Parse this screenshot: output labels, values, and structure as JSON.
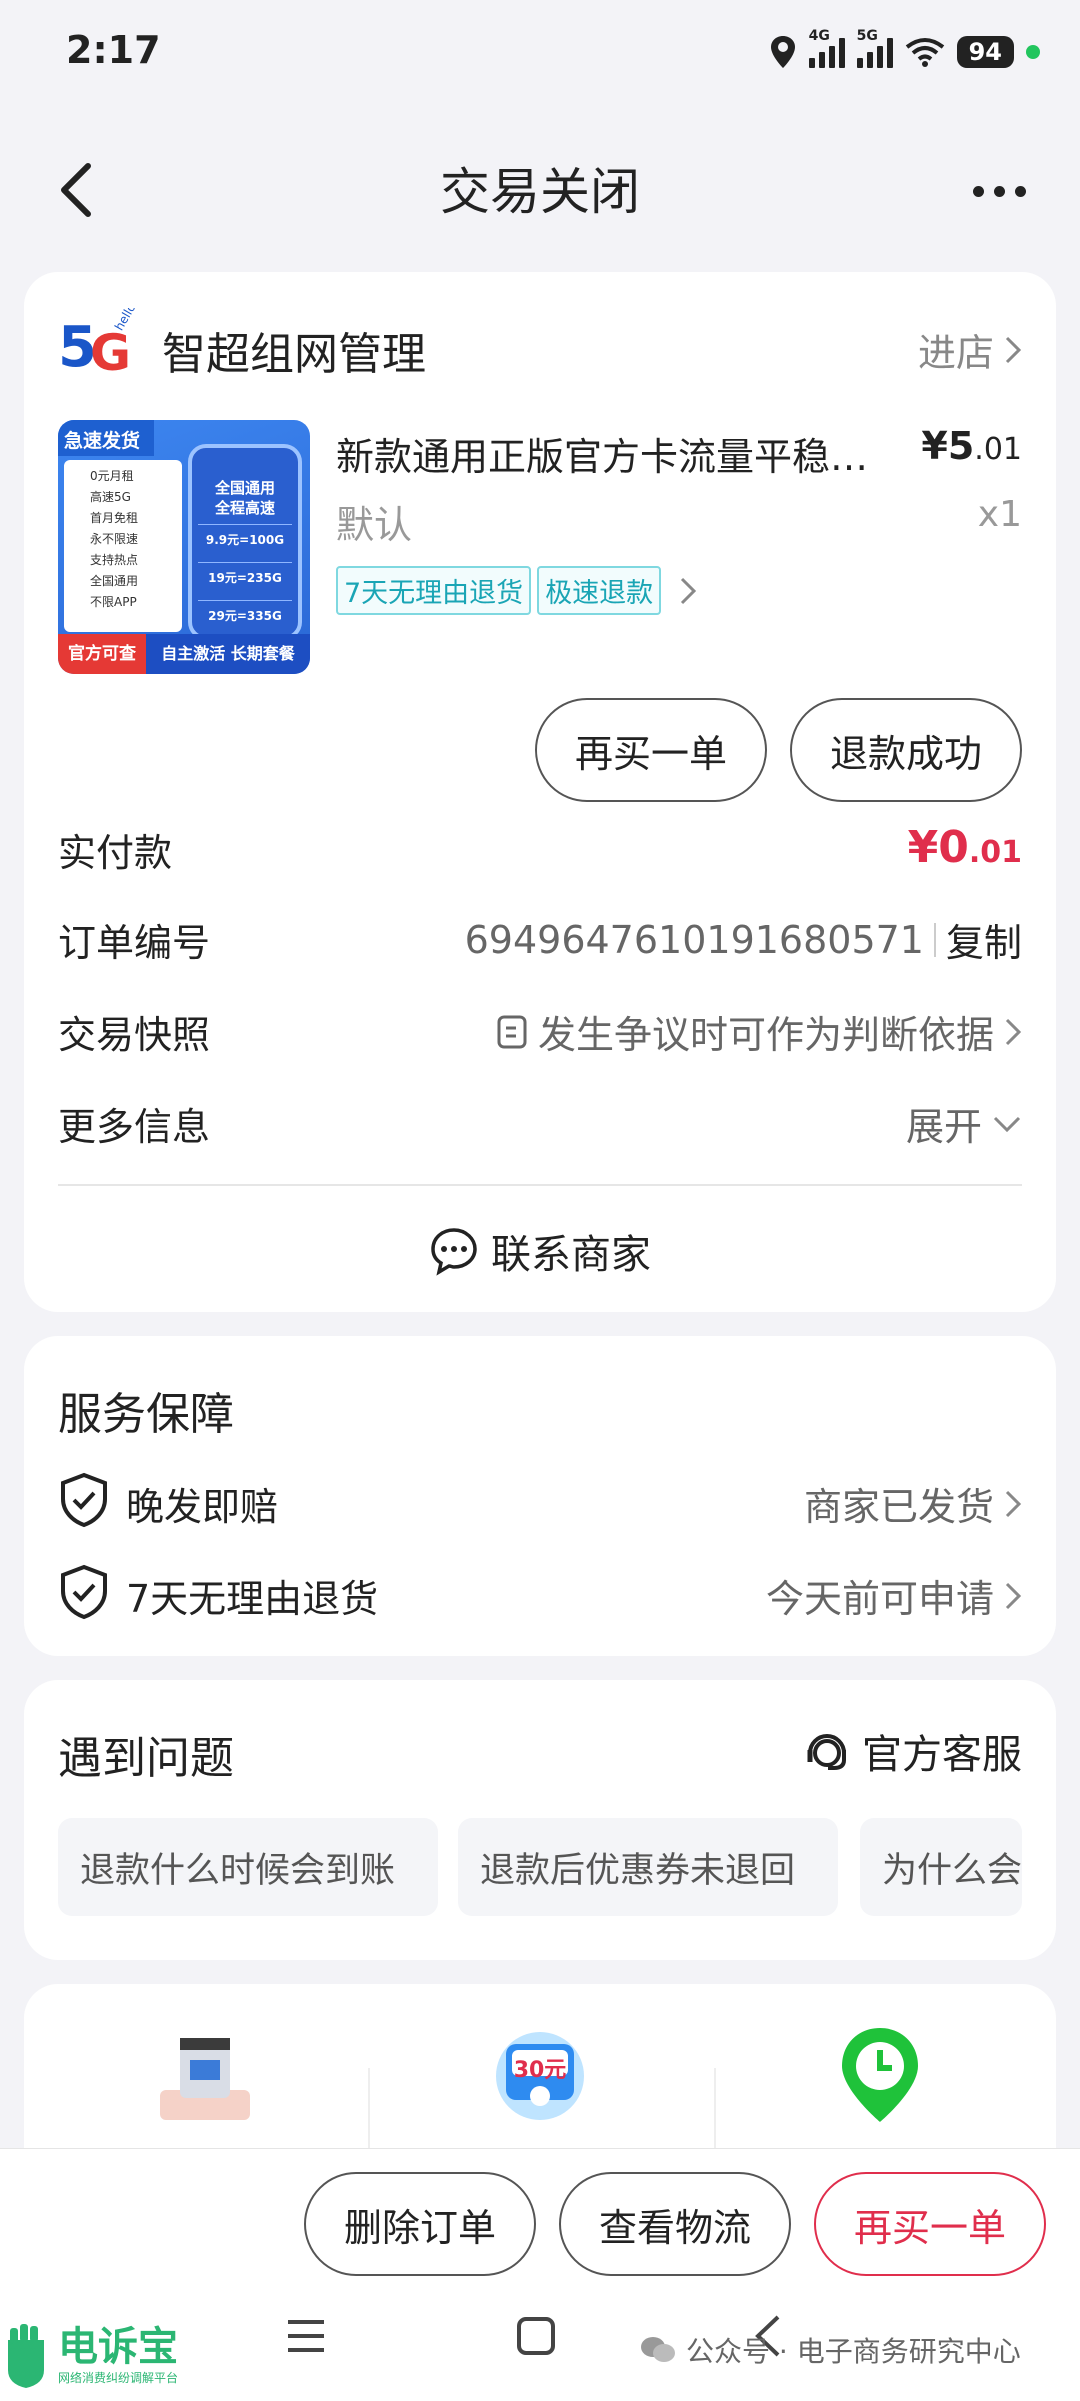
{
  "status": {
    "time": "2:17",
    "battery": "94",
    "net1": "4G",
    "net2": "5G"
  },
  "header": {
    "title": "交易关闭"
  },
  "shop": {
    "logo_text": "5G",
    "logo_sub": "hello",
    "name": "智超组网管理",
    "enter": "进店"
  },
  "product": {
    "thumb": {
      "head": "急速发货",
      "list": [
        "0元月租",
        "高速5G",
        "首月免租",
        "永不限速",
        "支持热点",
        "全国通用",
        "不限APP"
      ],
      "phone_title": "全国通用\n全程高速",
      "plans": [
        "9.9元=100G",
        "19元=235G",
        "29元=335G"
      ],
      "foot_left": "官方可查",
      "foot_right": "自主激活 长期套餐"
    },
    "title": "新款通用正版官方卡流量平稳…",
    "price_main": "¥5",
    "price_dec": ".01",
    "sku": "默认",
    "qty": "x1",
    "tags": [
      "7天无理由退货",
      "极速退款"
    ]
  },
  "actions": {
    "rebuy": "再买一单",
    "refund": "退款成功"
  },
  "order": {
    "paid_label": "实付款",
    "paid_main": "¥0",
    "paid_dec": ".01",
    "no_label": "订单编号",
    "no_value": "6949647610191680571",
    "copy": "复制",
    "snapshot_label": "交易快照",
    "snapshot_value": "发生争议时可作为判断依据",
    "more_label": "更多信息",
    "more_value": "展开",
    "contact": "联系商家"
  },
  "service": {
    "title": "服务保障",
    "items": [
      {
        "label": "晚发即赔",
        "value": "商家已发货"
      },
      {
        "label": "7天无理由退货",
        "value": "今天前可申请"
      }
    ]
  },
  "faq": {
    "title": "遇到问题",
    "support": "官方客服",
    "chips": [
      "退款什么时候会到账",
      "退款后优惠券未退回",
      "为什么会"
    ]
  },
  "promo": {
    "coupon": "30元"
  },
  "bottom": {
    "delete": "删除订单",
    "logistics": "查看物流",
    "rebuy": "再买一单"
  },
  "watermark": {
    "brand": "电诉宝",
    "brand_sub": "网络消费纠纷调解平台",
    "account": "公众号 · 电子商务研究中心"
  }
}
